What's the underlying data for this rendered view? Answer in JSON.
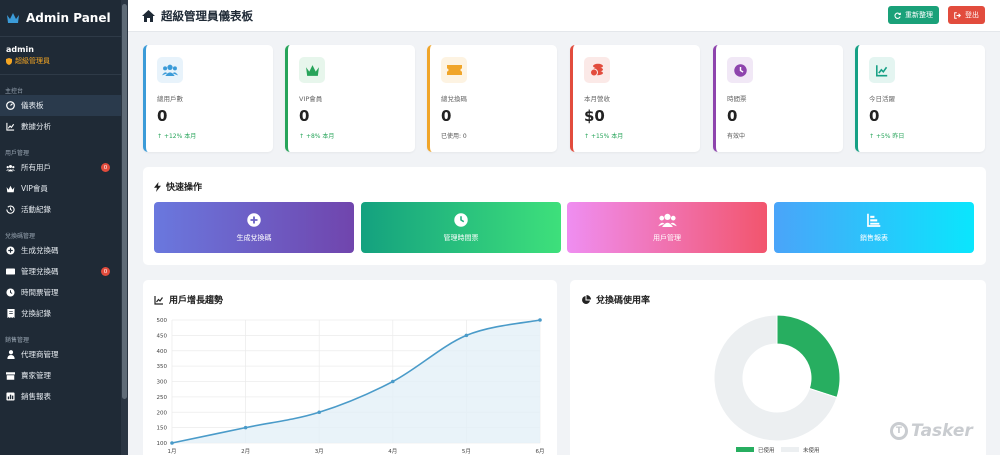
{
  "sidebar": {
    "brand": "Admin Panel",
    "user_name": "admin",
    "user_role": "超級管理員",
    "sections": [
      {
        "title": "主控台",
        "items": [
          {
            "label": "儀表板",
            "icon": "dashboard-icon",
            "active": true
          },
          {
            "label": "數據分析",
            "icon": "line-chart-icon"
          }
        ]
      },
      {
        "title": "用戶管理",
        "items": [
          {
            "label": "所有用戶",
            "icon": "users-icon",
            "badge": "0"
          },
          {
            "label": "VIP會員",
            "icon": "crown-icon"
          },
          {
            "label": "活動紀錄",
            "icon": "history-icon"
          }
        ]
      },
      {
        "title": "兌換碼管理",
        "items": [
          {
            "label": "生成兌換碼",
            "icon": "plus-circle-icon"
          },
          {
            "label": "管理兌換碼",
            "icon": "ticket-icon",
            "badge": "0"
          },
          {
            "label": "時間票管理",
            "icon": "clock-icon"
          },
          {
            "label": "兌換記錄",
            "icon": "receipt-icon"
          }
        ]
      },
      {
        "title": "銷售管理",
        "items": [
          {
            "label": "代理商管理",
            "icon": "user-tie-icon"
          },
          {
            "label": "賣家管理",
            "icon": "store-icon"
          },
          {
            "label": "銷售報表",
            "icon": "report-icon"
          }
        ]
      }
    ]
  },
  "header": {
    "title": "超級管理員儀表板",
    "refresh_label": "重新整理",
    "logout_label": "登出"
  },
  "stats": [
    {
      "label": "總用戶數",
      "value": "0",
      "sub": "+12% 本月",
      "trend": "up",
      "color": "#3b9bd8",
      "icon_bg": "#e8f3fb",
      "icon": "users-icon"
    },
    {
      "label": "VIP會員",
      "value": "0",
      "sub": "+8% 本月",
      "trend": "up",
      "color": "#27a45a",
      "icon_bg": "#e7f6ec",
      "icon": "crown-icon"
    },
    {
      "label": "總兌換碼",
      "value": "0",
      "sub": "已使用: 0",
      "trend": "none",
      "color": "#f0a52a",
      "icon_bg": "#fdf3e2",
      "icon": "ticket-icon"
    },
    {
      "label": "本月營收",
      "value": "$0",
      "sub": "+15% 本月",
      "trend": "up",
      "color": "#e24c3d",
      "icon_bg": "#fbe9e7",
      "icon": "coins-icon"
    },
    {
      "label": "時間票",
      "value": "0",
      "sub": "有效中",
      "trend": "none",
      "color": "#8e44ad",
      "icon_bg": "#f1e8f6",
      "icon": "clock-icon"
    },
    {
      "label": "今日活躍",
      "value": "0",
      "sub": "+5% 昨日",
      "trend": "up",
      "color": "#16a085",
      "icon_bg": "#e4f5f1",
      "icon": "line-chart-icon"
    }
  ],
  "quick_actions": {
    "title": "快速操作",
    "items": [
      {
        "label": "生成兌換碼",
        "icon": "plus-circle-icon"
      },
      {
        "label": "管理時間票",
        "icon": "clock-icon"
      },
      {
        "label": "用戶管理",
        "icon": "users-icon"
      },
      {
        "label": "銷售報表",
        "icon": "bar-chart-icon"
      }
    ]
  },
  "line_panel_title": "用戶增長趨勢",
  "pie_panel_title": "兌換碼使用率",
  "chart_data": [
    {
      "type": "area",
      "categories": [
        "1月",
        "2月",
        "3月",
        "4月",
        "5月",
        "6月"
      ],
      "values": [
        100,
        150,
        200,
        300,
        450,
        500
      ],
      "ylim": [
        100,
        500
      ],
      "yticks": [
        100,
        150,
        200,
        250,
        300,
        350,
        400,
        450,
        500
      ],
      "grid": true,
      "line_color": "#4a9bc9",
      "fill_color": "#e4f0f8"
    },
    {
      "type": "pie",
      "donut": true,
      "labels": [
        "已使用",
        "未使用"
      ],
      "values": [
        30,
        70
      ],
      "colors": [
        "#27ae60",
        "#eceff1"
      ],
      "legend": "bottom"
    }
  ],
  "watermark": "Tasker"
}
